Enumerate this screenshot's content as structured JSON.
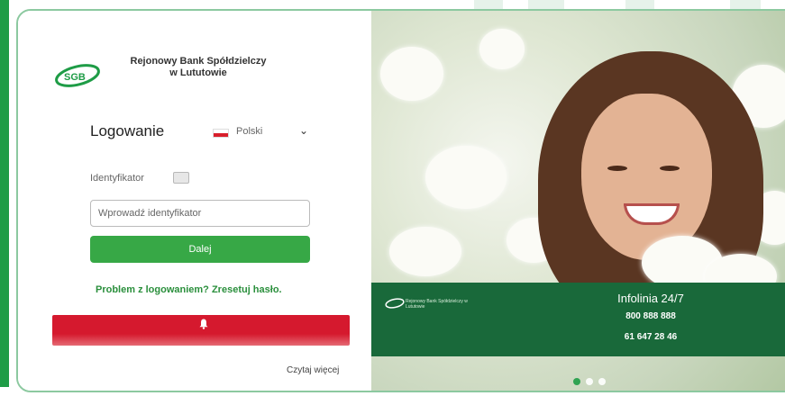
{
  "bank": {
    "logo_text": "SGB",
    "name_line1": "Rejonowy Bank Spółdzielczy",
    "name_line2": "w Lututowie"
  },
  "login": {
    "title": "Logowanie",
    "language": "Polski",
    "identifier_label": "Identyfikator",
    "identifier_placeholder": "Wprowadź identyfikator",
    "next_button": "Dalej",
    "problem_link": "Problem z logowaniem? Zresetuj hasło."
  },
  "alert": {
    "text": "",
    "read_more": "Czytaj więcej"
  },
  "infobox": {
    "logo_text": "Rejonowy Bank Spółdzielczy w Lututowie",
    "title": "Infolinia 24/7",
    "phone1": "800 888 888",
    "note1": "",
    "phone2": "61 647 28 46",
    "note2": ""
  },
  "carousel": {
    "slides": 3,
    "active": 1
  },
  "colors": {
    "brand_green": "#1e9c46",
    "button_green": "#37a846",
    "alert_red": "#d5192e",
    "info_green": "#19693a"
  },
  "icons": {
    "language_flag": "poland-flag-icon",
    "dropdown": "chevron-down-icon",
    "help": "keyboard-icon",
    "alert": "bell-icon"
  }
}
